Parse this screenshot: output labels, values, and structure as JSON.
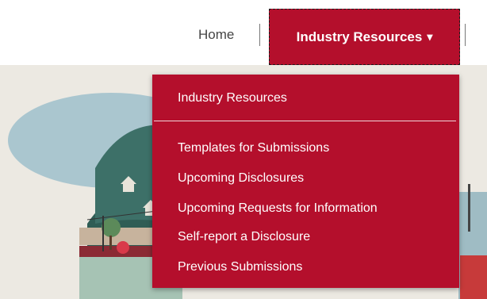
{
  "nav": {
    "home_label": "Home",
    "active_label": "Industry Resources",
    "caret": "▾"
  },
  "dropdown": {
    "header": "Industry Resources",
    "items": [
      "Templates for Submissions",
      "Upcoming Disclosures",
      "Upcoming Requests for Information",
      "Self-report a Disclosure",
      "Previous Submissions"
    ]
  },
  "colors": {
    "accent": "#b40f2c",
    "hero_background": "#ece9e2"
  }
}
